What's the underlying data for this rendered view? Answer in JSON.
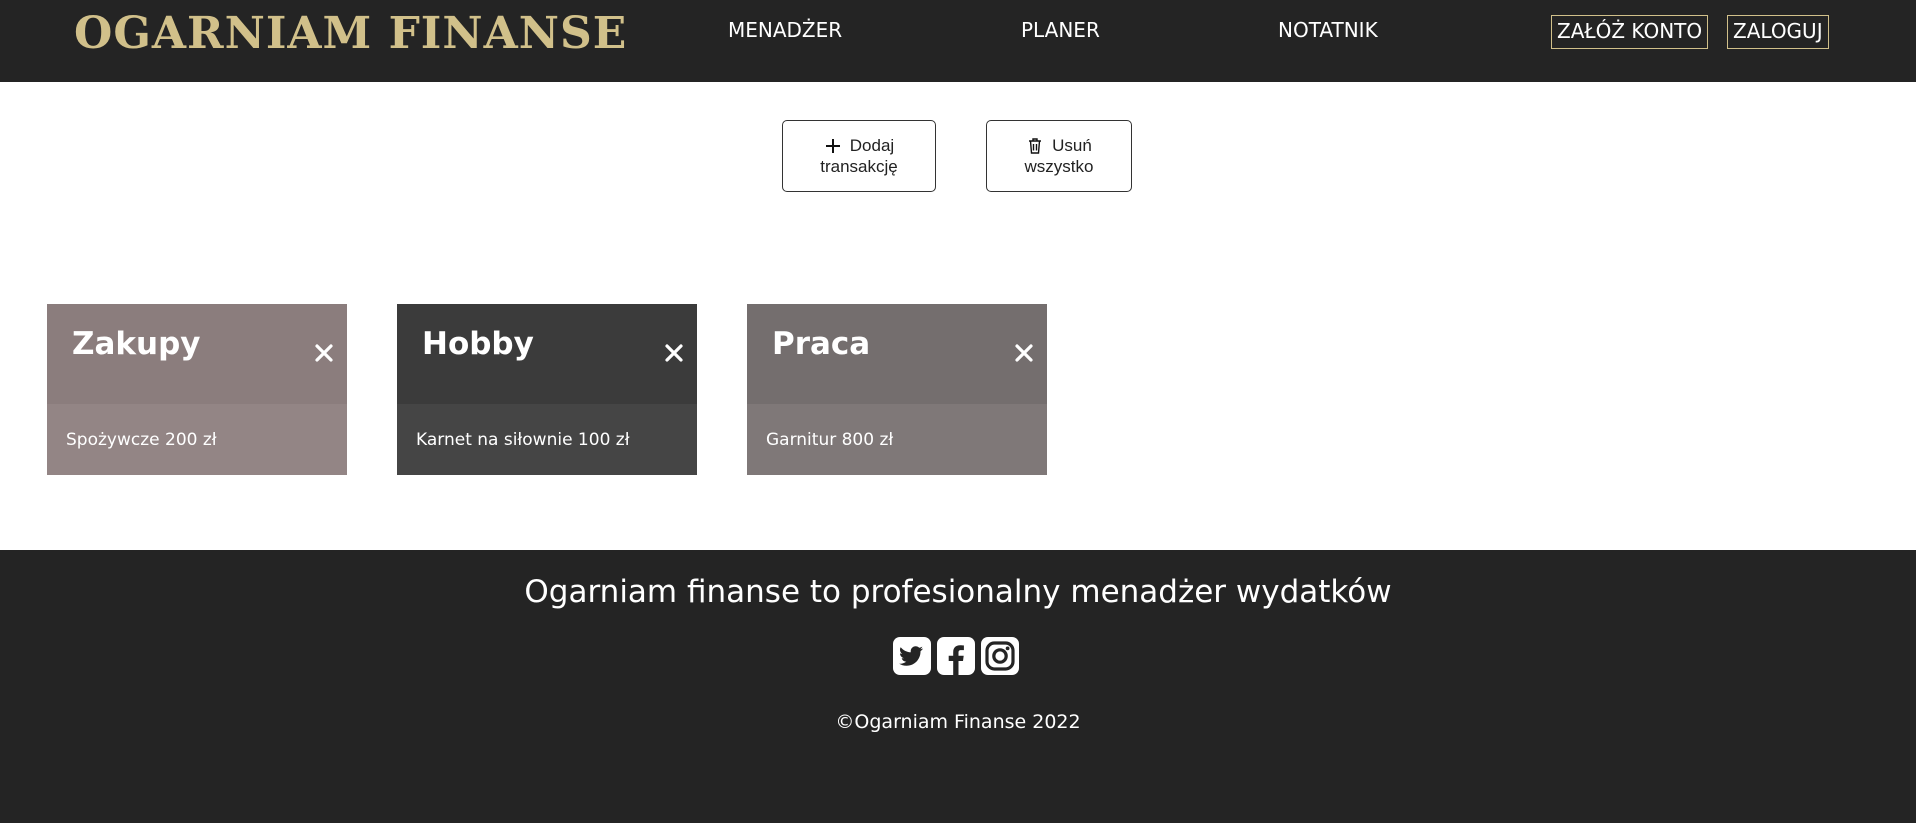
{
  "header": {
    "logo": "OGARNIAM FINANSE",
    "nav": [
      "MENADŻER",
      "PLANER",
      "NOTATNIK"
    ],
    "register_label": "ZAŁÓŻ KONTO",
    "login_label": "ZALOGUJ"
  },
  "actions": {
    "add_line1": "Dodaj",
    "add_line2": "transakcję",
    "delete_line1": "Usuń",
    "delete_line2": "wszystko"
  },
  "categories": [
    {
      "title": "Zakupy",
      "item": "Spożywcze 200 zł",
      "head_color": "#8b7d7d",
      "body_color": "#938585"
    },
    {
      "title": "Hobby",
      "item": "Karnet na siłownie 100 zł",
      "head_color": "#3b3b3b",
      "body_color": "#454545"
    },
    {
      "title": "Praca",
      "item": "Garnitur 800 zł",
      "head_color": "#746e6e",
      "body_color": "#7f7878"
    }
  ],
  "footer": {
    "tagline": "Ogarniam finanse to profesionalny menadżer wydatków",
    "socials": [
      "twitter-icon",
      "facebook-icon",
      "instagram-icon"
    ],
    "copyright": "©Ogarniam Finanse 2022"
  },
  "colors": {
    "bar": "#242424",
    "accent": "#d1c08a"
  }
}
